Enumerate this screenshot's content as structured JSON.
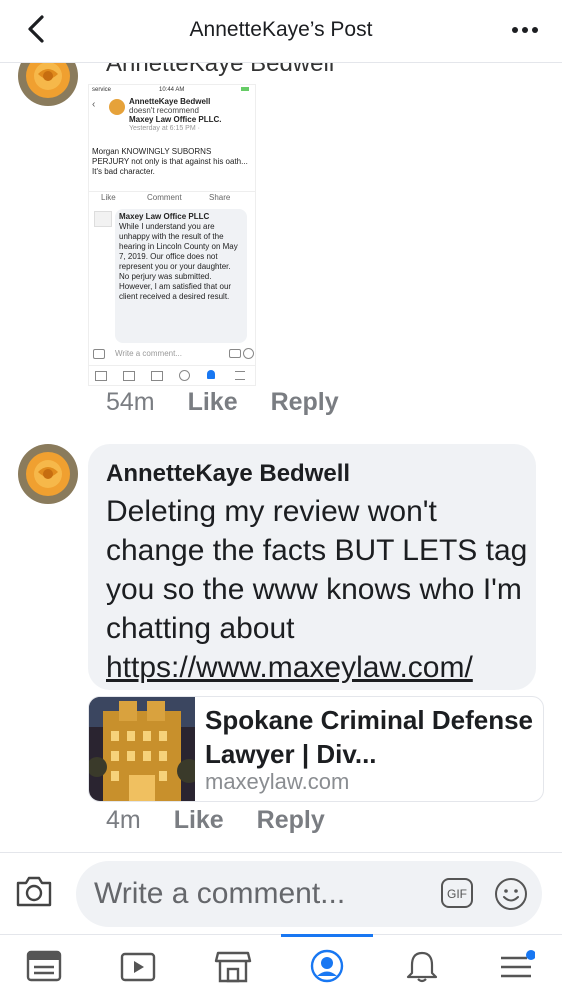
{
  "header": {
    "title": "AnnetteKaye’s Post",
    "back_icon": "chevron-left-icon",
    "more_icon": "more-horizontal-icon"
  },
  "comments": [
    {
      "author": "AnnetteKaye Bedwell",
      "time": "54m",
      "like_label": "Like",
      "reply_label": "Reply",
      "screenshot": {
        "status_left": "service",
        "status_time": "10:44 AM",
        "post_author": "AnnetteKaye Bedwell",
        "post_action": "doesn't recommend",
        "post_target": "Maxey Law Office PLLC.",
        "post_time": "Yesterday at 6:15 PM ·",
        "post_text": "Morgan KNOWINGLY SUBORNS PERJURY not only is that against his oath... It's bad character.",
        "like": "Like",
        "comment": "Comment",
        "share": "Share",
        "reply_author": "Maxey Law Office PLLC",
        "reply_text": "While I understand you are unhappy with the result of the hearing in Lincoln County on May 7, 2019. Our office does not represent you or your daughter. No perjury was submitted. However, I am satisfied that our client received a desired result.",
        "input_placeholder": "Write a comment..."
      }
    },
    {
      "author": "AnnetteKaye Bedwell",
      "text": "Deleting my review won't change the facts BUT LETS tag you so the www knows who I'm chatting about",
      "link": "https://www.maxeylaw.com/",
      "link_card": {
        "title": "Spokane Criminal Defense Lawyer | Div...",
        "domain": "maxeylaw.com"
      },
      "time": "4m",
      "like_label": "Like",
      "reply_label": "Reply"
    }
  ],
  "composer": {
    "placeholder": "Write a comment...",
    "gif_label": "GIF"
  },
  "tabs": [
    "news-feed-icon",
    "watch-icon",
    "marketplace-icon",
    "profile-icon",
    "notifications-icon",
    "menu-icon"
  ],
  "colors": {
    "accent": "#1877f2",
    "bubble": "#f0f2f5",
    "meta": "#7a7d82"
  }
}
